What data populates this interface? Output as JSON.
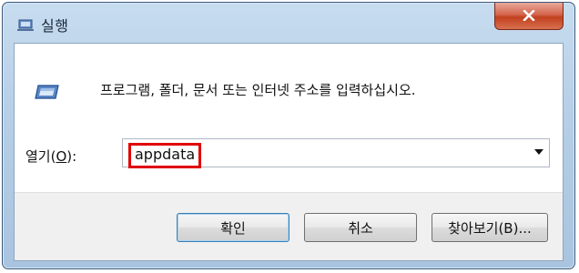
{
  "window": {
    "title": "실행",
    "icons": {
      "title": "run-icon",
      "close": "close-icon",
      "content": "run-icon"
    }
  },
  "body": {
    "instruction": "프로그램, 폴더, 문서 또는 인터넷 주소를 입력하십시오.",
    "open_label_prefix": "열기(",
    "open_label_mnemonic": "O",
    "open_label_suffix": "):",
    "open_value": "appdata"
  },
  "buttons": {
    "ok": "확인",
    "cancel": "취소",
    "browse": "찾아보기(B)..."
  },
  "colors": {
    "highlight": "#e00000",
    "close": "#c2401f"
  }
}
